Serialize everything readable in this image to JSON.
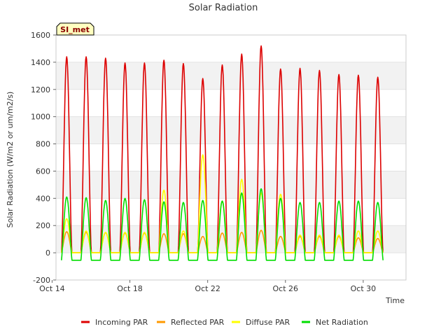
{
  "chart_data": {
    "type": "line",
    "title": "Solar Radiation",
    "xlabel": "Time",
    "ylabel": "Solar Radiation (W/m2 or um/m2/s)",
    "site_label": "SI_met",
    "xlim": [
      14.2,
      32.2
    ],
    "ylim": [
      -200,
      1600
    ],
    "yticks": [
      -200,
      0,
      200,
      400,
      600,
      800,
      1000,
      1200,
      1400,
      1600
    ],
    "xticks": [
      {
        "day": 14,
        "label": "Oct 14"
      },
      {
        "day": 18,
        "label": "Oct 18"
      },
      {
        "day": 22,
        "label": "Oct 22"
      },
      {
        "day": 26,
        "label": "Oct 26"
      },
      {
        "day": 30,
        "label": "Oct 30"
      }
    ],
    "grid": "horizontal alternating bands",
    "legend_position": "bottom",
    "noon_days": [
      14.75,
      15.75,
      16.75,
      17.75,
      18.75,
      19.75,
      20.75,
      21.75,
      22.75,
      23.75,
      24.75,
      25.75,
      26.75,
      27.75,
      28.75,
      29.75,
      30.75
    ],
    "series": [
      {
        "name": "Incoming PAR",
        "color": "#dd0000",
        "daily_peaks": [
          1440,
          1440,
          1430,
          1395,
          1395,
          1415,
          1390,
          1280,
          1380,
          1460,
          1520,
          1350,
          1355,
          1340,
          1310,
          1305,
          1290
        ]
      },
      {
        "name": "Reflected PAR",
        "color": "#ff9900",
        "daily_peaks": [
          155,
          150,
          148,
          145,
          145,
          140,
          140,
          120,
          145,
          150,
          165,
          120,
          120,
          120,
          120,
          110,
          105
        ]
      },
      {
        "name": "Diffuse PAR",
        "color": "#ffff00",
        "daily_peaks": [
          250,
          160,
          150,
          150,
          150,
          460,
          160,
          720,
          380,
          540,
          440,
          430,
          130,
          130,
          130,
          160,
          160
        ]
      },
      {
        "name": "Net Radiation",
        "color": "#00dd00",
        "daily_peaks": [
          410,
          405,
          385,
          400,
          390,
          375,
          370,
          385,
          380,
          440,
          470,
          400,
          370,
          370,
          380,
          380,
          370
        ],
        "night_value": -55
      }
    ]
  }
}
